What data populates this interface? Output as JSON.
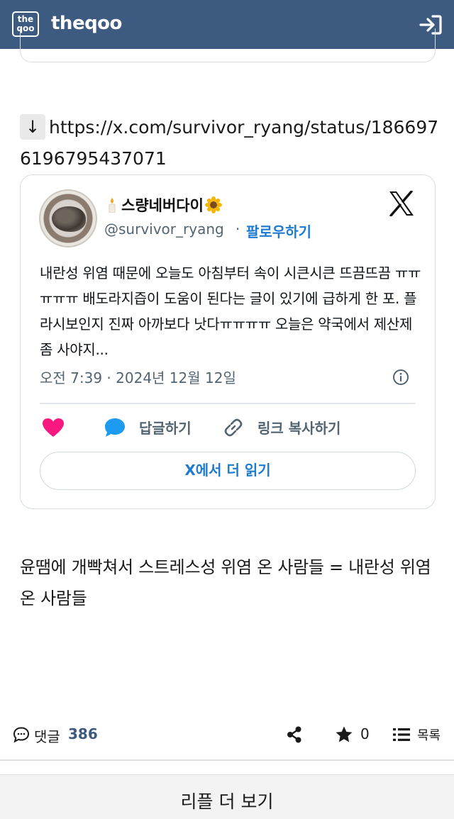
{
  "header": {
    "logo_line1": "the",
    "logo_line2": "qoo",
    "site_name": "theqoo",
    "login_icon": "login-icon"
  },
  "post": {
    "arrow": "↓",
    "link_text": "https://x.com/survivor_ryang/status/1866976196795437071",
    "tweet": {
      "display_name": "스량네버다이",
      "handle": "@survivor_ryang",
      "separator": "·",
      "follow_label": "팔로우하기",
      "text": "내란성 위염 때문에 오늘도 아침부터 속이 시큰시큰 뜨끔뜨끔 ㅠㅠㅠㅠㅠ 배도라지즙이 도움이 된다는 글이 있기에 급하게 한 포. 플라시보인지 진짜 아까보다 낫다ㅠㅠㅠㅠ 오늘은 약국에서 제산제 좀 사야지...",
      "timestamp": "오전 7:39 · 2024년 12월 12일",
      "reply_label": "답글하기",
      "copy_link_label": "링크 복사하기",
      "read_more_label": "X에서 더 읽기",
      "colors": {
        "accent": "#1d7bd0",
        "heart": "#f91880",
        "muted": "#536471"
      }
    },
    "body_text": "윤땜에 개빡쳐서 스트레스성 위염 온 사람들 = 내란성 위염온 사람들"
  },
  "footer": {
    "comment_label": "댓글",
    "comment_count": "386",
    "star_count": "0",
    "list_label": "목록",
    "more_replies_label": "리플 더 보기"
  },
  "theme": {
    "header_bg": "#3d5a80"
  }
}
